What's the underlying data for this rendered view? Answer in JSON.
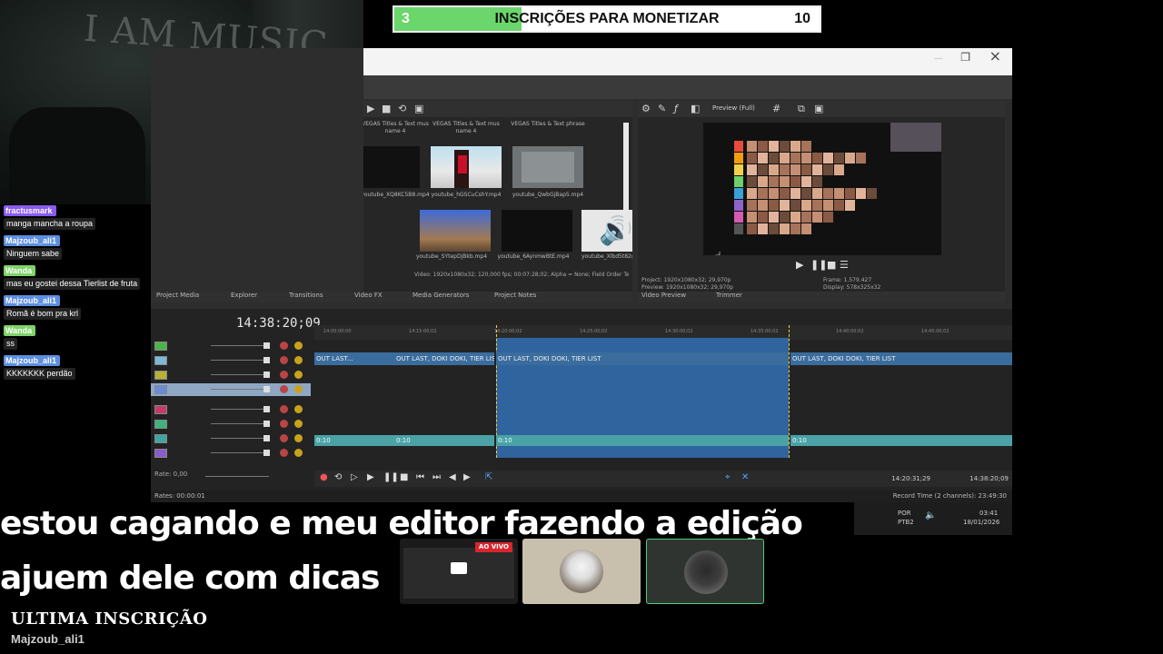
{
  "goal": {
    "current": "3",
    "label": "INSCRIÇÕES PARA MONETIZAR",
    "target": "10",
    "progress": 0.3,
    "fill_color": "#6bd66b"
  },
  "webcam": {
    "sign_text": "I AM MUSIC"
  },
  "editor": {
    "media_titles": [
      "VEGAS Titles & Text mus name 4",
      "VEGAS Titles & Text mus name 4",
      "VEGAS Titles & Text phrase"
    ],
    "media_files": [
      "youtube_XQ8KC5B8.mp4",
      "youtube_hGSCuCshY.mp4",
      "youtube_QwbGjBap5.mp4",
      "youtube_SYtepDjBkb.mp4",
      "youtube_6AynmwBtE.mp4",
      "youtube_Xlbd5t82g.mp4"
    ],
    "media_info": "Video: 1920x1080x32; 120,000 fps; 00:07:28;02; Alpha = None; Field Order Test = None (progressive scan); AAC",
    "left_tabs": [
      "Project Media",
      "Explorer",
      "Transitions",
      "Video FX",
      "Media Generators",
      "Project Notes"
    ],
    "preview_mode": "Preview (Full)",
    "preview_info": [
      {
        "label": "Project:",
        "value": "1920x1080x32; 29,970p"
      },
      {
        "label": "Preview:",
        "value": "1920x1080x32; 29,970p"
      },
      {
        "label": "Frame:",
        "value": "1.579.427"
      },
      {
        "label": "Display:",
        "value": "578x325x32"
      }
    ],
    "preview_tabs": [
      "Video Preview",
      "Trimmer"
    ],
    "timecode": "14:38:20;09",
    "ruler_marks": [
      "14:00:00;00",
      "14:15:00;02",
      "14:20:00;02",
      "14:25:00;02",
      "14:30:00;02",
      "14:35:00;02",
      "14:40:00;02",
      "14:45:00;02"
    ],
    "clip_label": "OUT LAST, DOKI DOKI, TIER LIST",
    "clip_short": "OUT LAST...",
    "audio_label": "0:10",
    "rate": "Rate: 0,00",
    "transport_time": "14:20:31;29",
    "transport_time2": "14:38:20;09",
    "status_left": "Rates: 00:00:01",
    "status_right": "Record Time (2 channels): 23:49:30"
  },
  "chat": [
    {
      "user": "fractusmark",
      "message": "manga mancha a roupa",
      "color": "#8a5cf0"
    },
    {
      "user": "Majzoub_ali1",
      "message": "Ninguem sabe",
      "color": "#5d8fe0"
    },
    {
      "user": "Wanda",
      "message": "mas eu gostei dessa Tierlist de fruta",
      "color": "#7fd36a"
    },
    {
      "user": "Majzoub_ali1",
      "message": "Romã é bom pra krl",
      "color": "#5d8fe0"
    },
    {
      "user": "Wanda",
      "message": "ss",
      "color": "#7fd36a"
    },
    {
      "user": "Majzoub_ali1",
      "message": "KKKKKKK perdão",
      "color": "#5d8fe0"
    }
  ],
  "caption": {
    "line1": "estou cagando e meu editor fazendo a edição",
    "line2": "ajuem dele com dicas"
  },
  "tiles": {
    "live_badge": "AO VIVO"
  },
  "tray": {
    "lang1": "POR",
    "lang2": "PTB2",
    "time": "03:41",
    "date": "18/01/2026"
  },
  "last_sub": {
    "title": "ULTIMA INSCRIÇÃO",
    "user": "Majzoub_ali1"
  },
  "icons": {
    "close": "close-icon",
    "maximize": "maximize-icon",
    "speaker": "speaker-icon",
    "play": "play-icon"
  }
}
